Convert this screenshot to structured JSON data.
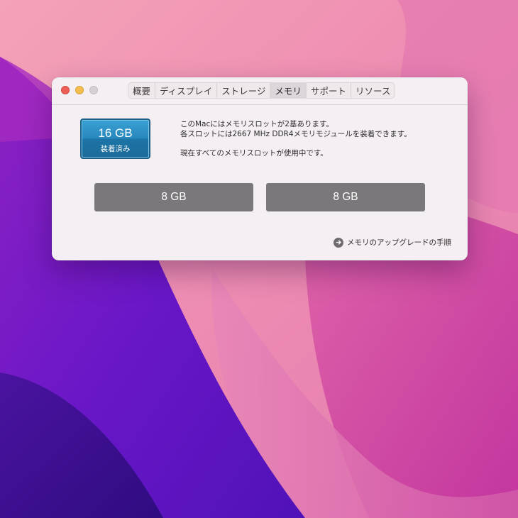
{
  "window": {
    "tabs": [
      {
        "label": "概要",
        "active": false
      },
      {
        "label": "ディスプレイ",
        "active": false
      },
      {
        "label": "ストレージ",
        "active": false
      },
      {
        "label": "メモリ",
        "active": true
      },
      {
        "label": "サポート",
        "active": false
      },
      {
        "label": "リソース",
        "active": false
      }
    ]
  },
  "memory": {
    "total": "16 GB",
    "status": "装着済み",
    "info_line1": "このMacにはメモリスロットが2基あります。",
    "info_line2": "各スロットには2667 MHz DDR4メモリモジュールを装着できます。",
    "info_line3": "現在すべてのメモリスロットが使用中です。",
    "slots": [
      "8 GB",
      "8 GB"
    ],
    "upgrade_link": "メモリのアップグレードの手順",
    "upgrade_icon": "arrow-right-circle-icon"
  },
  "colors": {
    "badge_blue": "#2888bd",
    "slot_gray": "#7a787a",
    "close_red": "#ed5f57",
    "minimize_yellow": "#f5bd4f",
    "zoom_gray": "#d5d0d3"
  }
}
